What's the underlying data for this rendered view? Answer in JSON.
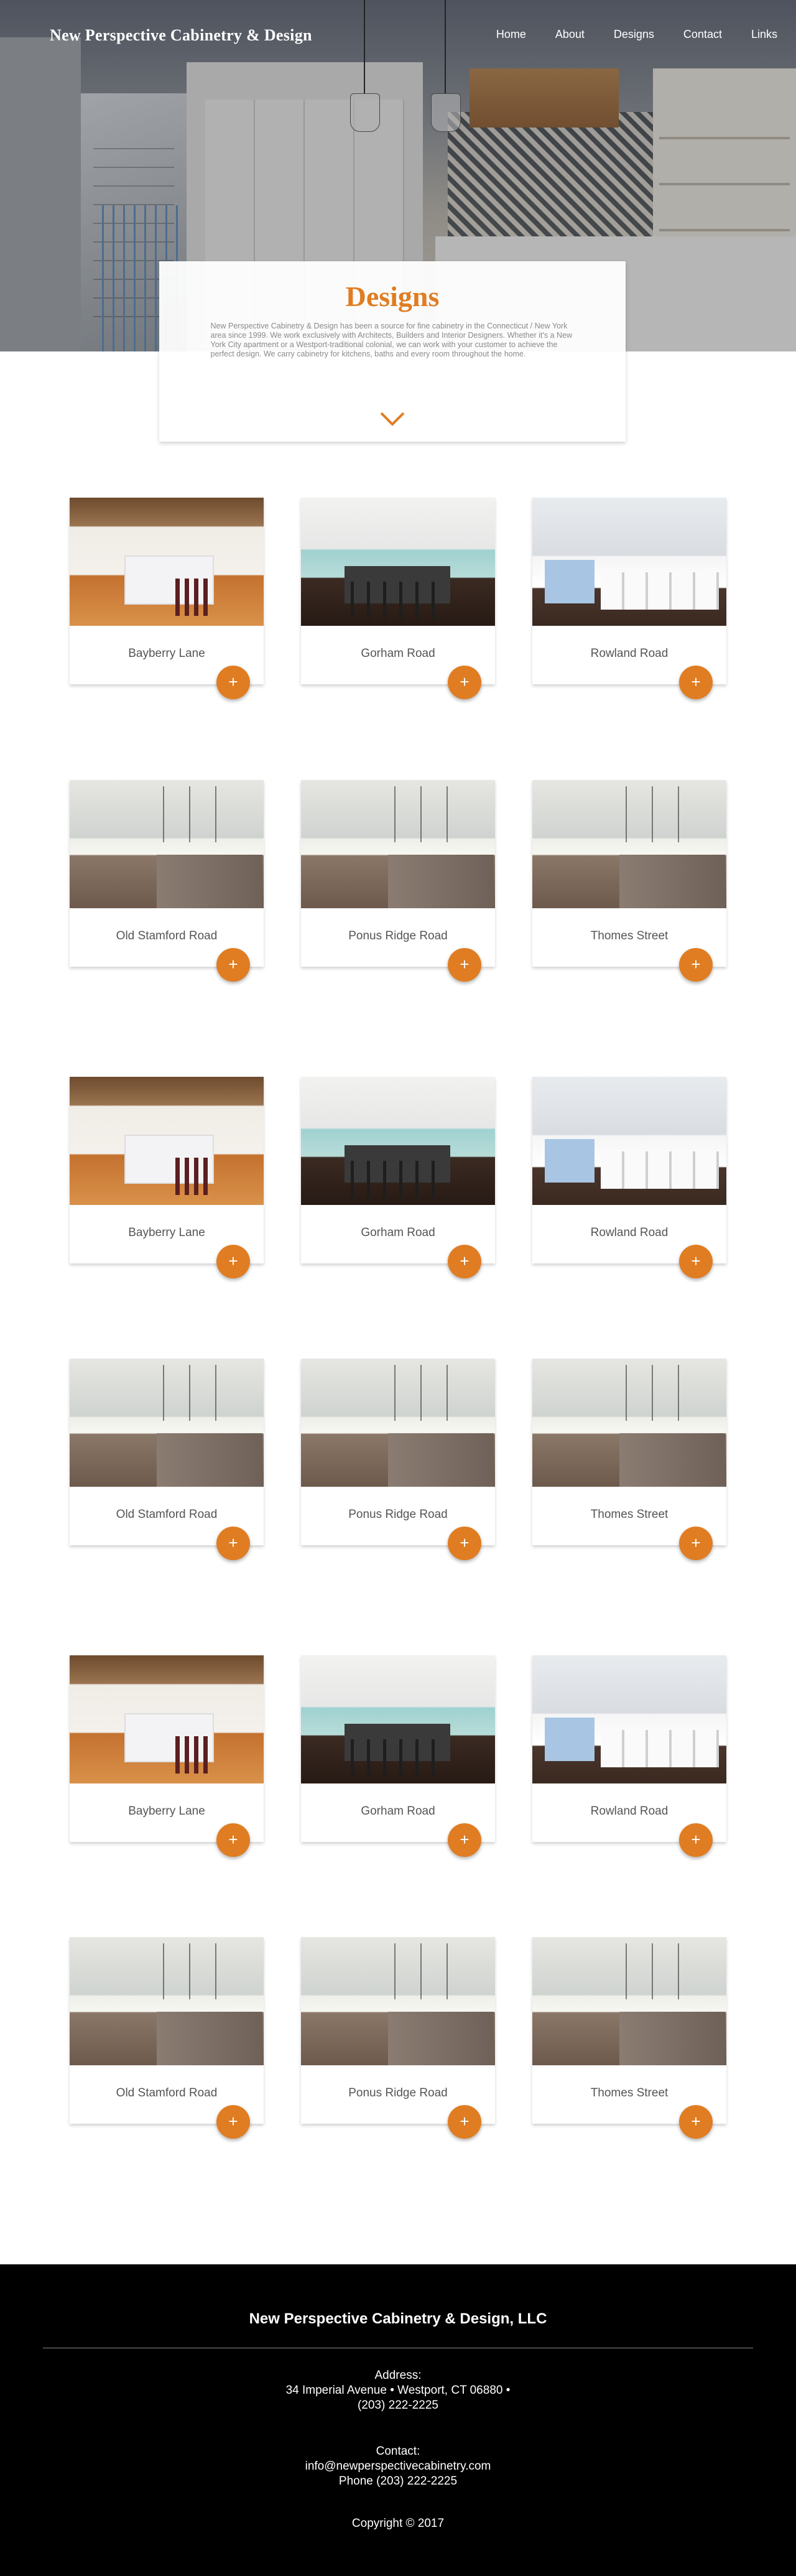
{
  "site": {
    "brand": "New Perspective Cabinetry & Design"
  },
  "nav": [
    {
      "label": "Home"
    },
    {
      "label": "About"
    },
    {
      "label": "Designs"
    },
    {
      "label": "Contact"
    },
    {
      "label": "Links"
    }
  ],
  "intro": {
    "title": "Designs",
    "text": "New Perspective Cabinetry & Design has been a source for fine cabinetry in the Connecticut / New York area since 1999. We work exclusively with Architects, Builders and Interior Designers. Whether it's a New York City apartment or a Westport-traditional colonial, we can work with your customer to achieve the perfect design. We carry cabinetry for kitchens, baths and every room throughout the home."
  },
  "projects": [
    {
      "name": "Bayberry Lane"
    },
    {
      "name": "Gorham Road"
    },
    {
      "name": "Rowland Road"
    },
    {
      "name": "Old Stamford Road"
    },
    {
      "name": "Ponus Ridge Road"
    },
    {
      "name": "Thomes Street"
    },
    {
      "name": "Bayberry Lane"
    },
    {
      "name": "Gorham Road"
    },
    {
      "name": "Rowland Road"
    },
    {
      "name": "Old Stamford Road"
    },
    {
      "name": "Ponus Ridge Road"
    },
    {
      "name": "Thomes Street"
    },
    {
      "name": "Bayberry Lane"
    },
    {
      "name": "Gorham Road"
    },
    {
      "name": "Rowland Road"
    },
    {
      "name": "Old Stamford Road"
    },
    {
      "name": "Ponus Ridge Road"
    },
    {
      "name": "Thomes Street"
    }
  ],
  "card_button": "+",
  "footer": {
    "company": "New Perspective Cabinetry & Design, LLC",
    "address_label": "Address:",
    "address_line": "34 Imperial Avenue • Westport, CT 06880 •",
    "address_phone": "(203) 222-2225",
    "contact_label": "Contact:",
    "email": "info@newperspectivecabinetry.com",
    "phone": "Phone (203) 222-2225",
    "copyright": "Copyright © 2017"
  },
  "colors": {
    "accent": "#e07d22",
    "footer_bg": "#000000"
  },
  "icons": {
    "scroll": "chevron-down-icon",
    "card_action": "plus-icon"
  }
}
